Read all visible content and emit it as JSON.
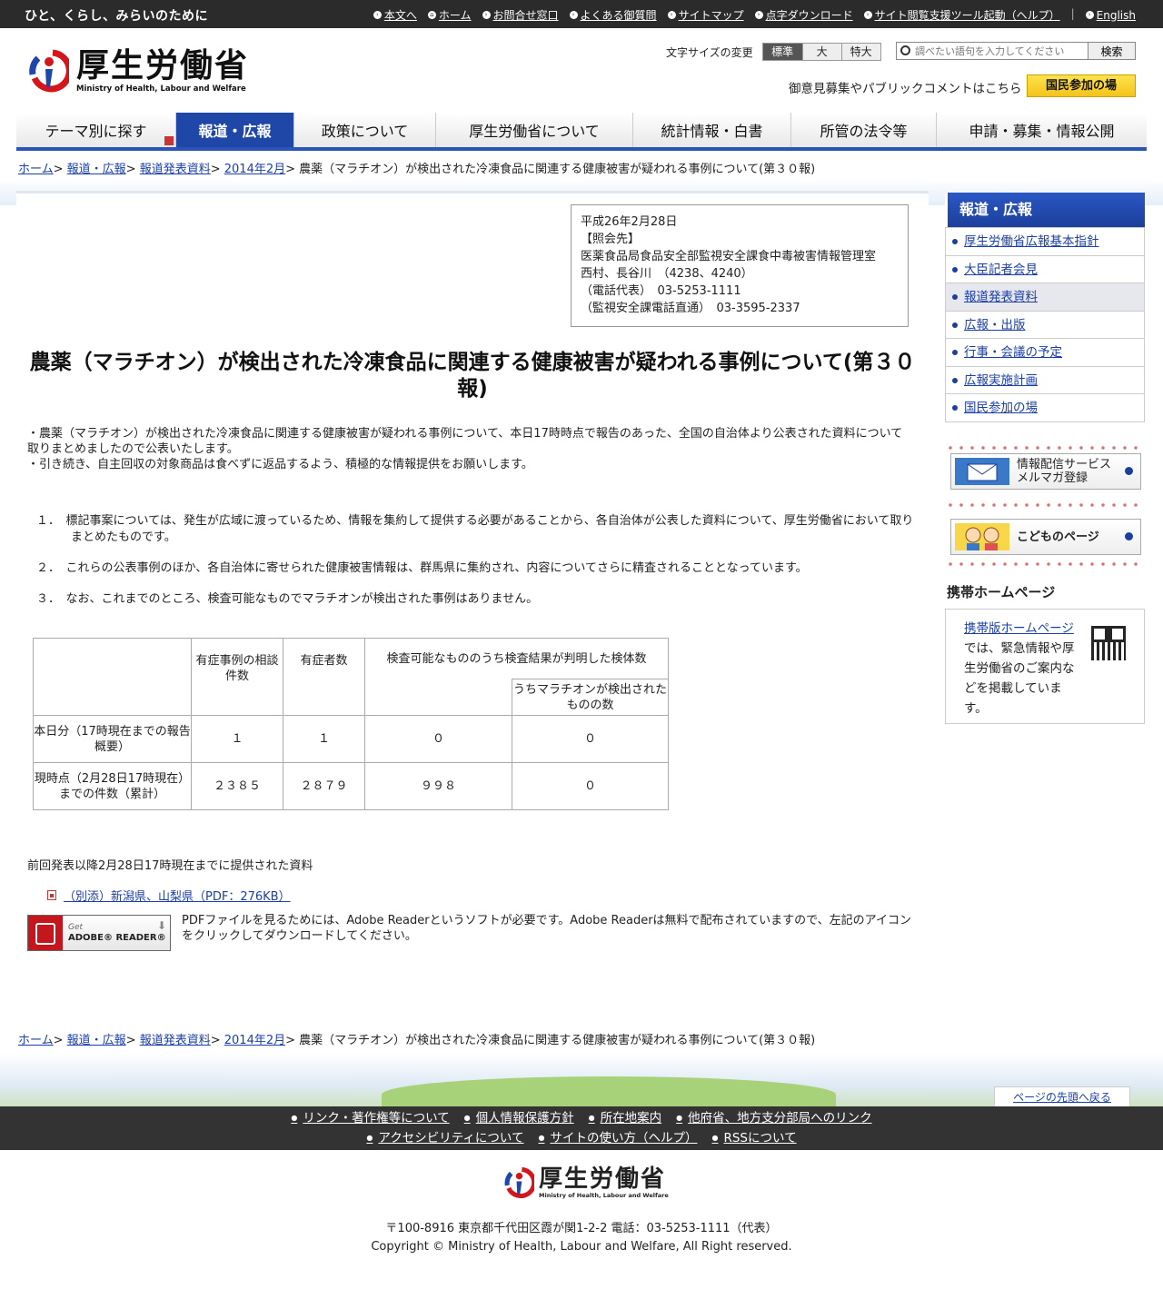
{
  "topbar": {
    "tagline": "ひと、くらし、みらいのために",
    "links": [
      "本文へ",
      "ホーム",
      "お問合せ窓口",
      "よくある御質問",
      "サイトマップ",
      "点字ダウンロード",
      "サイト閲覧支援ツール起動（ヘルプ）",
      "English"
    ]
  },
  "header": {
    "logo_jp": "厚生労働省",
    "logo_en": "Ministry of Health, Labour and Welfare",
    "fontsize_label": "文字サイズの変更",
    "fontsize_options": [
      "標準",
      "大",
      "特大"
    ],
    "search_placeholder": "調べたい語句を入力してください",
    "search_button": "検索",
    "pubcomment": "御意見募集やパブリックコメントはこちら",
    "sanka_button": "国民参加の場"
  },
  "gnav": [
    "テーマ別に探す",
    "報道・広報",
    "政策について",
    "厚生労働省について",
    "統計情報・白書",
    "所管の法令等",
    "申請・募集・情報公開"
  ],
  "breadcrumb": {
    "items": [
      "ホーム",
      "報道・広報",
      "報道発表資料",
      "2014年2月"
    ],
    "current": "農薬（マラチオン）が検出された冷凍食品に関連する健康被害が疑われる事例について(第３０報)"
  },
  "contact": {
    "lines": [
      "平成26年2月28日",
      "【照会先】",
      "医薬食品局食品安全部監視安全課食中毒被害情報管理室",
      "西村、長谷川　（4238、4240）",
      "（電話代表）　03-5253-1111",
      "（監視安全課電話直通）　03-3595-2337"
    ]
  },
  "main": {
    "title": "農薬（マラチオン）が検出された冷凍食品に関連する健康被害が疑われる事例について(第３０報)",
    "intro1": "・農薬（マラチオン）が検出された冷凍食品に関連する健康被害が疑われる事例について、本日17時時点で報告のあった、全国の自治体より公表された資料について取りまとめましたので公表いたします。",
    "intro2": "・引き続き、自主回収の対象商品は食べずに返品するよう、積極的な情報提供をお願いします。",
    "items": [
      "１．　標記事案については、発生が広域に渡っているため、情報を集約して提供する必要があることから、各自治体が公表した資料について、厚生労働省において取りまとめたものです。",
      "２．　これらの公表事例のほか、各自治体に寄せられた健康被害情報は、群馬県に集約され、内容についてさらに精査されることとなっています。",
      "３．　なお、これまでのところ、検査可能なものでマラチオンが検出された事例はありません。"
    ],
    "table": {
      "h1": "有症事例の相談件数",
      "h2": "有症者数",
      "h3": "検査可能なもののうち検査結果が判明した検体数",
      "h4": "うちマラチオンが検出されたものの数",
      "rows": [
        {
          "label": "本日分（17時現在までの報告概要）",
          "c1": "１",
          "c2": "１",
          "c3": "０",
          "c4": "０"
        },
        {
          "label": "現時点（2月28日17時現在）までの件数（累計）",
          "c1": "２３８５",
          "c2": "２８７９",
          "c3": "９９８",
          "c4": "０"
        }
      ]
    },
    "prev_label": "前回発表以降2月28日17時現在までに提供された資料",
    "pdf_link": "（別添）新潟県、山梨県（PDF：276KB）",
    "adobe_get": "Get",
    "adobe_reader": "ADOBE® READER®",
    "pdf_note": "PDFファイルを見るためには、Adobe Readerというソフトが必要です。Adobe Readerは無料で配布されていますので、左記のアイコンをクリックしてダウンロードしてください。"
  },
  "sidebar": {
    "head": "報道・広報",
    "items": [
      "厚生労働省広報基本指針",
      "大臣記者会見",
      "報道発表資料",
      "広報・出版",
      "行事・会議の予定",
      "広報実施計画",
      "国民参加の場"
    ],
    "mail_banner_1": "情報配信サービス",
    "mail_banner_2": "メルマガ登録",
    "kids_banner": "こどものページ",
    "mobile_title": "携帯ホームページ",
    "mobile_link": "携帯版ホームページ",
    "mobile_text": "では、緊急情報や厚生労働省のご案内などを掲載しています。"
  },
  "footer": {
    "pagetop": "ページの先頭へ戻る",
    "row1": [
      "リンク・著作権等について",
      "個人情報保護方針",
      "所在地案内",
      "他府省、地方支分部局へのリンク"
    ],
    "row2": [
      "アクセシビリティについて",
      "サイトの使い方（ヘルプ）",
      "RSSについて"
    ],
    "logo_jp": "厚生労働省",
    "logo_en": "Ministry of Health, Labour and Welfare",
    "address": "〒100-8916 東京都千代田区霞が関1-2-2 電話：03-5253-1111（代表）",
    "copyright": "Copyright © Ministry of Health, Labour and Welfare, All Right reserved."
  },
  "colors": {
    "nav_active": "#1e47a8",
    "topbar": "#2b2b2b",
    "link": "#1a3fa8"
  }
}
